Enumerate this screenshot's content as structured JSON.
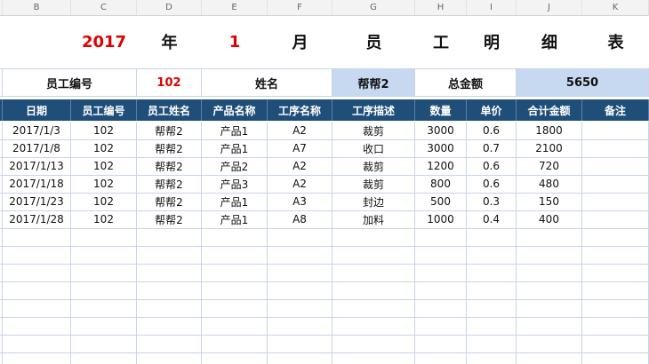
{
  "columns": [
    "B",
    "C",
    "D",
    "E",
    "F",
    "G",
    "H",
    "I",
    "J",
    "K"
  ],
  "title": {
    "year": "2017",
    "nian": "年",
    "month": "1",
    "yue": "月",
    "chars": [
      "员",
      "工",
      "明",
      "细",
      "表"
    ]
  },
  "info": {
    "emp_no_label": "员工编号",
    "emp_no_value": "102",
    "name_label": "姓名",
    "name_value": "帮帮2",
    "total_label": "总金额",
    "total_value": "5650"
  },
  "headers": [
    "日期",
    "员工编号",
    "员工姓名",
    "产品名称",
    "工序名称",
    "工序描述",
    "数量",
    "单价",
    "合计金额",
    "备注"
  ],
  "rows": [
    [
      "2017/1/3",
      "102",
      "帮帮2",
      "产品1",
      "A2",
      "裁剪",
      "3000",
      "0.6",
      "1800",
      ""
    ],
    [
      "2017/1/8",
      "102",
      "帮帮2",
      "产品1",
      "A7",
      "收口",
      "3000",
      "0.7",
      "2100",
      ""
    ],
    [
      "2017/1/13",
      "102",
      "帮帮2",
      "产品2",
      "A2",
      "裁剪",
      "1200",
      "0.6",
      "720",
      ""
    ],
    [
      "2017/1/18",
      "102",
      "帮帮2",
      "产品3",
      "A2",
      "裁剪",
      "800",
      "0.6",
      "480",
      ""
    ],
    [
      "2017/1/23",
      "102",
      "帮帮2",
      "产品1",
      "A3",
      "封边",
      "500",
      "0.3",
      "150",
      ""
    ],
    [
      "2017/1/28",
      "102",
      "帮帮2",
      "产品1",
      "A8",
      "加料",
      "1000",
      "0.4",
      "400",
      ""
    ]
  ],
  "empty_rows": 8
}
